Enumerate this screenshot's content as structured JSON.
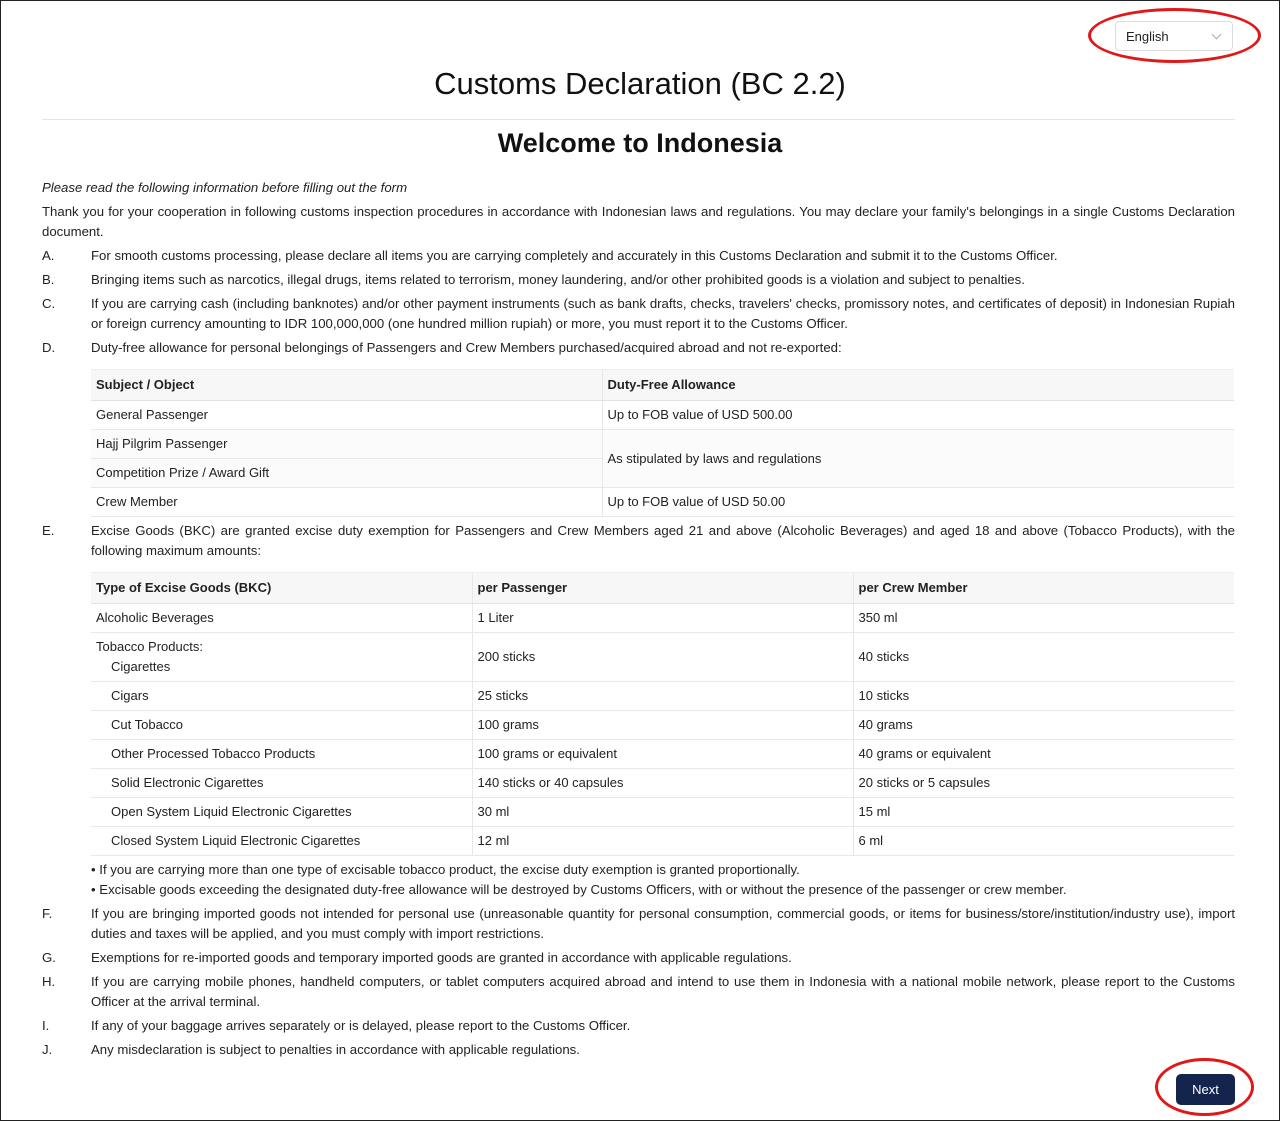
{
  "language": {
    "selected": "English"
  },
  "header": {
    "title": "Customs Declaration (BC 2.2)",
    "subtitle": "Welcome to Indonesia"
  },
  "content": {
    "note": "Please read the following information before filling out the form",
    "intro": "Thank you for your cooperation in following customs inspection procedures in accordance with Indonesian laws and regulations. You may declare your family's belongings in a single Customs Declaration document.",
    "items": {
      "a": {
        "letter": "A.",
        "text": "For smooth customs processing, please declare all items you are carrying completely and accurately in this Customs Declaration and submit it to the Customs Officer."
      },
      "b": {
        "letter": "B.",
        "text": "Bringing items such as narcotics, illegal drugs, items related to terrorism, money laundering, and/or other prohibited goods is a violation and subject to penalties."
      },
      "c": {
        "letter": "C.",
        "text": "If you are carrying cash (including banknotes) and/or other payment instruments (such as bank drafts, checks, travelers' checks, promissory notes, and certificates of deposit) in Indonesian Rupiah or foreign currency amounting to IDR 100,000,000 (one hundred million rupiah) or more, you must report it to the Customs Officer."
      },
      "d": {
        "letter": "D.",
        "text": "Duty-free allowance for personal belongings of Passengers and Crew Members purchased/acquired abroad and not re-exported:"
      },
      "e": {
        "letter": "E.",
        "text": "Excise Goods (BKC) are granted excise duty exemption for Passengers and Crew Members aged 21 and above (Alcoholic Beverages) and aged 18 and above (Tobacco Products), with the following maximum amounts:"
      },
      "f": {
        "letter": "F.",
        "text": "If you are bringing imported goods not intended for personal use (unreasonable quantity for personal consumption, commercial goods, or items for business/store/institution/industry use), import duties and taxes will be applied, and you must comply with import restrictions."
      },
      "g": {
        "letter": "G.",
        "text": "Exemptions for re-imported goods and temporary imported goods are granted in accordance with applicable regulations."
      },
      "h": {
        "letter": "H.",
        "text": "If you are carrying mobile phones, handheld computers, or tablet computers acquired abroad and intend to use them in Indonesia with a national mobile network, please report to the Customs Officer at the arrival terminal."
      },
      "i": {
        "letter": "I.",
        "text": "If any of your baggage arrives separately or is delayed, please report to the Customs Officer."
      },
      "j": {
        "letter": "J.",
        "text": "Any misdeclaration is subject to penalties in accordance with applicable regulations."
      }
    },
    "allowance_table": {
      "headers": [
        "Subject / Object",
        "Duty-Free Allowance"
      ],
      "rows": [
        [
          "General Passenger",
          "Up to FOB value of USD 500.00"
        ],
        [
          "Hajj Pilgrim Passenger",
          "As stipulated by laws and regulations"
        ],
        [
          "Competition Prize / Award Gift",
          ""
        ],
        [
          "Crew Member",
          "Up to FOB value of USD 50.00"
        ]
      ]
    },
    "excise_table": {
      "headers": [
        "Type of Excise Goods (BKC)",
        "per Passenger",
        "per Crew Member"
      ],
      "tobacco_label": "Tobacco Products:",
      "rows": [
        [
          "Alcoholic Beverages",
          "1 Liter",
          "350 ml"
        ],
        [
          "Cigarettes",
          "200 sticks",
          "40 sticks"
        ],
        [
          "Cigars",
          "25 sticks",
          "10 sticks"
        ],
        [
          "Cut Tobacco",
          "100 grams",
          "40 grams"
        ],
        [
          "Other Processed Tobacco Products",
          "100 grams or equivalent",
          "40 grams or equivalent"
        ],
        [
          "Solid Electronic Cigarettes",
          "140 sticks or 40 capsules",
          "20 sticks or 5 capsules"
        ],
        [
          "Open System Liquid Electronic Cigarettes",
          "30 ml",
          "15 ml"
        ],
        [
          "Closed System Liquid Electronic Cigarettes",
          "12 ml",
          "6 ml"
        ]
      ]
    },
    "excise_notes": [
      "• If you are carrying more than one type of excisable tobacco product, the excise duty exemption is granted proportionally.",
      "• Excisable goods exceeding the designated duty-free allowance will be destroyed by Customs Officers, with or without the presence of the passenger or crew member."
    ]
  },
  "footer": {
    "next_label": "Next"
  }
}
